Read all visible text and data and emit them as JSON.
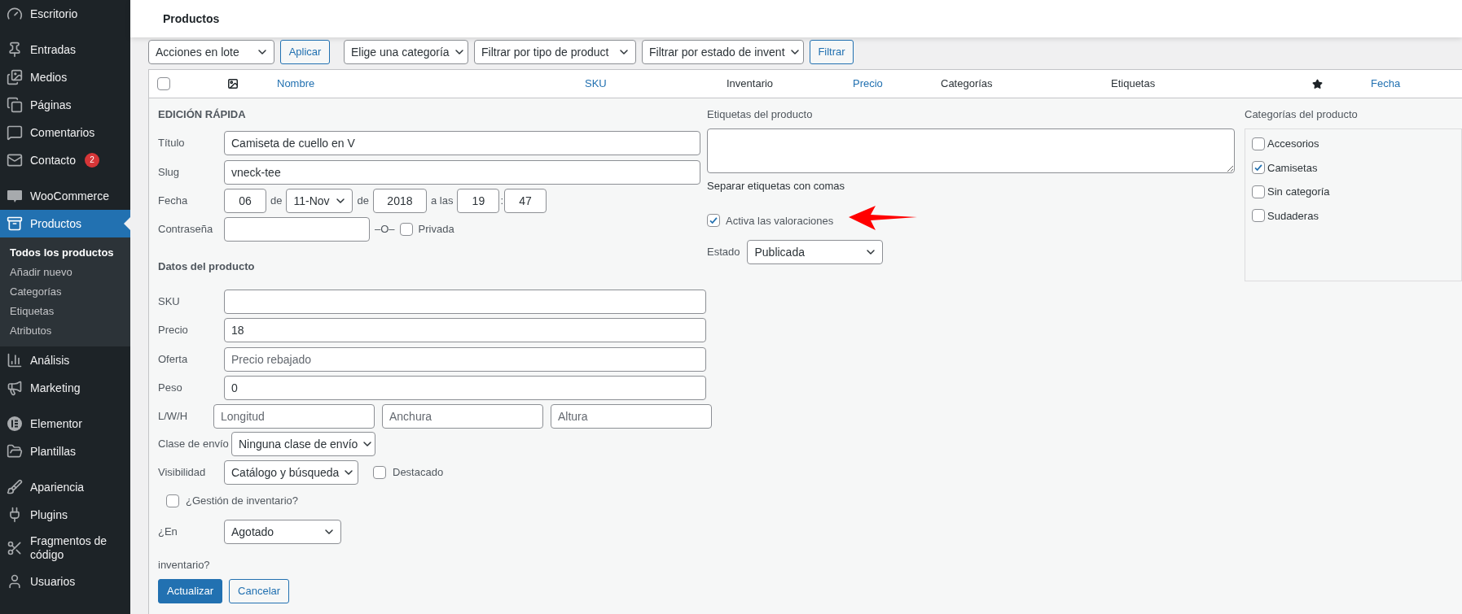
{
  "sidebar": {
    "groups": [
      [
        {
          "label": "Escritorio",
          "selected": false
        }
      ],
      [
        {
          "label": "Entradas",
          "selected": false
        },
        {
          "label": "Medios",
          "selected": false
        },
        {
          "label": "Páginas",
          "selected": false
        },
        {
          "label": "Comentarios",
          "selected": false
        },
        {
          "label": "Contacto",
          "selected": false,
          "badge": "2"
        }
      ],
      [
        {
          "label": "WooCommerce",
          "selected": false
        },
        {
          "label": "Productos",
          "selected": true,
          "children": [
            {
              "label": "Todos los productos",
              "selected": true
            },
            {
              "label": "Añadir nuevo",
              "selected": false
            },
            {
              "label": "Categorías",
              "selected": false
            },
            {
              "label": "Etiquetas",
              "selected": false
            },
            {
              "label": "Atributos",
              "selected": false
            }
          ]
        },
        {
          "label": "Análisis",
          "selected": false
        },
        {
          "label": "Marketing",
          "selected": false
        }
      ],
      [
        {
          "label": "Elementor",
          "selected": false
        },
        {
          "label": "Plantillas",
          "selected": false
        }
      ],
      [
        {
          "label": "Apariencia",
          "selected": false
        },
        {
          "label": "Plugins",
          "selected": false
        },
        {
          "label": "Fragmentos de código",
          "selected": false
        },
        {
          "label": "Usuarios",
          "selected": false
        }
      ]
    ]
  },
  "page_title": "Productos",
  "toolbar": [
    {
      "kind": "select",
      "label": "Acciones en lote"
    },
    {
      "kind": "button",
      "label": "Aplicar"
    },
    {
      "kind": "select",
      "label": "Elige una categoría"
    },
    {
      "kind": "select",
      "label": "Filtrar por tipo de product"
    },
    {
      "kind": "select",
      "label": "Filtrar por estado de invent"
    },
    {
      "kind": "button",
      "label": "Filtrar"
    }
  ],
  "table": {
    "columns": [
      {
        "kind": "checkbox",
        "checked": false
      },
      {
        "kind": "image"
      },
      {
        "kind": "text",
        "label": "Nombre",
        "link": true
      },
      {
        "kind": "text",
        "label": "SKU",
        "link": true
      },
      {
        "kind": "text",
        "label": "Inventario",
        "link": false
      },
      {
        "kind": "text",
        "label": "Precio",
        "link": true
      },
      {
        "kind": "text",
        "label": "Categorías",
        "link": false
      },
      {
        "kind": "text",
        "label": "Etiquetas",
        "link": false
      },
      {
        "kind": "star"
      },
      {
        "kind": "text",
        "label": "Fecha",
        "link": true
      }
    ]
  },
  "quick_edit": {
    "heading": "EDICIÓN RÁPIDA",
    "title": {
      "label": "Título",
      "value": "Camiseta de cuello en V"
    },
    "slug": {
      "label": "Slug",
      "value": "vneck-tee"
    },
    "date": {
      "label": "Fecha",
      "day": "06",
      "sep_1": "de",
      "month": "11-Nov",
      "sep_2": "de",
      "year": "2018",
      "sep_3": "a las",
      "hour": "19",
      "colon": ":",
      "minute": "47"
    },
    "password": {
      "label": "Contraseña",
      "or": "–O–",
      "private": {
        "label": "Privada",
        "checked": false
      }
    },
    "product_data": {
      "heading": "Datos del producto",
      "sku": {
        "label": "SKU"
      },
      "price": {
        "label": "Precio",
        "value": "18"
      },
      "sale": {
        "label": "Oferta",
        "placeholder": "Precio rebajado"
      },
      "weight": {
        "label": "Peso",
        "value": "0"
      },
      "dimensions": {
        "label": "L/W/H",
        "placeholders": [
          "Longitud",
          "Anchura",
          "Altura"
        ]
      },
      "shipping": {
        "label": "Clase de envío",
        "value": "Ninguna clase de envío"
      },
      "visibility": {
        "label": "Visibilidad",
        "value": "Catálogo y búsqueda"
      },
      "featured": {
        "label": "Destacado",
        "checked": false
      },
      "manage_stock": {
        "label": "¿Gestión de inventario?",
        "checked": false
      },
      "stock": {
        "label_1": "¿En",
        "label_2": "inventario?",
        "value": "Agotado"
      }
    },
    "buttons": [
      {
        "label": "Actualizar",
        "kind": "primary"
      },
      {
        "label": "Cancelar",
        "kind": "secondary"
      }
    ],
    "tags": {
      "label": "Etiquetas del producto",
      "help": "Separar etiquetas con comas"
    },
    "reviews": {
      "label": "Activa las valoraciones",
      "checked": true
    },
    "status": {
      "label": "Estado",
      "value": "Publicada"
    },
    "categories": {
      "label": "Categorías del producto",
      "items": [
        {
          "label": "Accesorios",
          "checked": false
        },
        {
          "label": "Camisetas",
          "checked": true
        },
        {
          "label": "Sin categoría",
          "checked": false
        },
        {
          "label": "Sudaderas",
          "checked": false
        }
      ]
    }
  }
}
